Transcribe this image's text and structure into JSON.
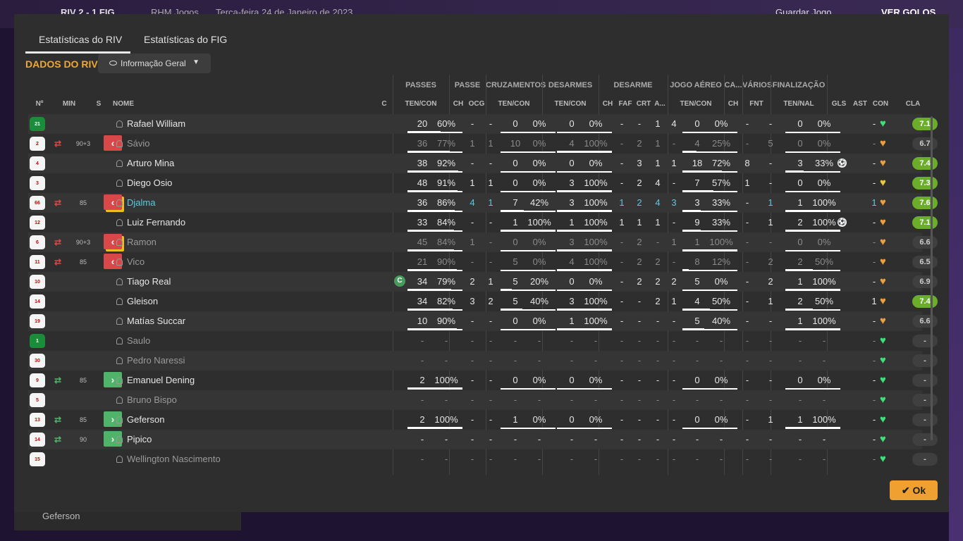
{
  "background": {
    "match_header": "RIV   2 - 1   FIG",
    "subtitle": "RHM Jogos",
    "date": "Terça-feira 24 de Janeiro de 2023",
    "save_button": "Guardar Jogo",
    "goals_button": "VER GOLOS",
    "bottom_player": "Geferson"
  },
  "tabs": [
    "Estatísticas do RIV",
    "Estatísticas do FIG"
  ],
  "section_title": "DADOS DO RIV",
  "dropdown": {
    "icon": "eye-icon",
    "label": "Informação Geral"
  },
  "groups": [
    "PASSES",
    "PASSE",
    "CRUZAMENTOS",
    "DESARMES",
    "DESARME",
    "JOGO AÉREO",
    "CA...",
    "VÁRIOS",
    "FINALIZAÇÃO"
  ],
  "columns": {
    "num": "Nº",
    "min": "MIN",
    "s": "S",
    "name": "NOME",
    "c": "C",
    "pass": "TEN/CON",
    "ch": "CH",
    "ocg": "OCG",
    "cross": "TEN/CON",
    "tack": "TEN/CON",
    "dch": "CH",
    "faf": "FAF",
    "crt": "CRT",
    "a": "A...",
    "air": "TEN/CON",
    "cach": "CH",
    "fnt": "FNT",
    "fin": "TEN/NAL",
    "gls": "GLS",
    "ast": "AST",
    "con": "CON",
    "cla": "CLA"
  },
  "colors": {
    "accent": "#f0a830",
    "green": "#4fb36a",
    "red": "#d84848",
    "rating_high": "#6aae2c",
    "cyan": "#5fc8e0"
  },
  "players": [
    {
      "num": "21",
      "gk": true,
      "min": "",
      "sub": "",
      "name": "Rafael William",
      "c": "",
      "style": "",
      "pass": [
        "20",
        "60%"
      ],
      "ch": "-",
      "ocg": "-",
      "cross": [
        "0",
        "0%"
      ],
      "tack": [
        "0",
        "0%"
      ],
      "dch": "-",
      "faf": "-",
      "crt": "1",
      "a": "4",
      "air": [
        "0",
        "0%"
      ],
      "cach": "-",
      "fnt": "-",
      "fin": [
        "0",
        "0%"
      ],
      "gls": "",
      "ast": "-",
      "con": "green",
      "cla": "7.1",
      "high": true,
      "bars": {
        "pass": 0.6,
        "cross": 0,
        "tack": 0,
        "air": 0,
        "fin": 0
      }
    },
    {
      "num": "2",
      "gk": false,
      "min": "90+3",
      "sub": "out",
      "name": "Sávio",
      "c": "",
      "style": "dim",
      "pass": [
        "36",
        "77%"
      ],
      "ch": "1",
      "ocg": "1",
      "cross": [
        "10",
        "0%"
      ],
      "tack": [
        "4",
        "100%"
      ],
      "dch": "-",
      "faf": "2",
      "crt": "1",
      "a": "-",
      "air": [
        "4",
        "25%"
      ],
      "cach": "-",
      "fnt": "5",
      "fin": [
        "0",
        "0%"
      ],
      "gls": "",
      "ast": "-",
      "con": "orange",
      "cla": "6.7",
      "high": false,
      "bars": {
        "pass": 0.77,
        "cross": 0,
        "tack": 1,
        "air": 0.25,
        "fin": 0
      }
    },
    {
      "num": "4",
      "gk": false,
      "min": "",
      "sub": "",
      "name": "Arturo Mina",
      "c": "",
      "style": "",
      "pass": [
        "38",
        "92%"
      ],
      "ch": "-",
      "ocg": "-",
      "cross": [
        "0",
        "0%"
      ],
      "tack": [
        "0",
        "0%"
      ],
      "dch": "-",
      "faf": "3",
      "crt": "1",
      "a": "1",
      "air": [
        "18",
        "72%"
      ],
      "cach": "8",
      "fnt": "-",
      "fin": [
        "3",
        "33%"
      ],
      "gls": "ball",
      "ast": "-",
      "con": "orange",
      "cla": "7.4",
      "high": true,
      "bars": {
        "pass": 0.92,
        "cross": 0,
        "tack": 0,
        "air": 0.72,
        "fin": 0.33
      }
    },
    {
      "num": "3",
      "gk": false,
      "min": "",
      "sub": "",
      "name": "Diego Osio",
      "c": "",
      "style": "",
      "pass": [
        "48",
        "91%"
      ],
      "ch": "1",
      "ocg": "1",
      "cross": [
        "0",
        "0%"
      ],
      "tack": [
        "3",
        "100%"
      ],
      "dch": "-",
      "faf": "2",
      "crt": "4",
      "a": "-",
      "air": [
        "7",
        "57%"
      ],
      "cach": "1",
      "fnt": "-",
      "fin": [
        "0",
        "0%"
      ],
      "gls": "",
      "ast": "-",
      "con": "yellow",
      "cla": "7.3",
      "high": true,
      "bars": {
        "pass": 0.91,
        "cross": 0,
        "tack": 1,
        "air": 0.57,
        "fin": 0
      }
    },
    {
      "num": "66",
      "gk": false,
      "min": "85",
      "sub": "out-yellow",
      "name": "Djalma",
      "c": "",
      "style": "cyan",
      "pass": [
        "36",
        "86%"
      ],
      "ch": "4",
      "ocg": "1",
      "cross": [
        "7",
        "42%"
      ],
      "tack": [
        "3",
        "100%"
      ],
      "dch": "1",
      "faf": "2",
      "crt": "4",
      "a": "3",
      "air": [
        "3",
        "33%"
      ],
      "cach": "-",
      "fnt": "1",
      "fin": [
        "1",
        "100%"
      ],
      "gls": "",
      "ast": "1",
      "con": "orange",
      "cla": "7.6",
      "high": true,
      "bars": {
        "pass": 0.86,
        "cross": 0.42,
        "tack": 1,
        "air": 0.33,
        "fin": 1
      }
    },
    {
      "num": "12",
      "gk": false,
      "min": "",
      "sub": "",
      "name": "Luiz Fernando",
      "c": "",
      "style": "",
      "pass": [
        "33",
        "84%"
      ],
      "ch": "-",
      "ocg": "-",
      "cross": [
        "1",
        "100%"
      ],
      "tack": [
        "1",
        "100%"
      ],
      "dch": "1",
      "faf": "1",
      "crt": "1",
      "a": "-",
      "air": [
        "9",
        "33%"
      ],
      "cach": "-",
      "fnt": "1",
      "fin": [
        "2",
        "100%"
      ],
      "gls": "ball",
      "ast": "-",
      "con": "orange",
      "cla": "7.1",
      "high": true,
      "bars": {
        "pass": 0.84,
        "cross": 1,
        "tack": 1,
        "air": 0.33,
        "fin": 1
      }
    },
    {
      "num": "6",
      "gk": false,
      "min": "90+3",
      "sub": "out-yellow",
      "name": "Ramon",
      "c": "",
      "style": "dim",
      "pass": [
        "45",
        "84%"
      ],
      "ch": "1",
      "ocg": "-",
      "cross": [
        "0",
        "0%"
      ],
      "tack": [
        "3",
        "100%"
      ],
      "dch": "-",
      "faf": "2",
      "crt": "-",
      "a": "1",
      "air": [
        "1",
        "100%"
      ],
      "cach": "-",
      "fnt": "-",
      "fin": [
        "0",
        "0%"
      ],
      "gls": "",
      "ast": "-",
      "con": "orange",
      "cla": "6.6",
      "high": false,
      "bars": {
        "pass": 0.84,
        "cross": 0,
        "tack": 1,
        "air": 1,
        "fin": 0
      }
    },
    {
      "num": "11",
      "gk": false,
      "min": "85",
      "sub": "out",
      "name": "Vico",
      "c": "",
      "style": "dim",
      "pass": [
        "21",
        "90%"
      ],
      "ch": "-",
      "ocg": "-",
      "cross": [
        "5",
        "0%"
      ],
      "tack": [
        "4",
        "100%"
      ],
      "dch": "-",
      "faf": "2",
      "crt": "2",
      "a": "-",
      "air": [
        "8",
        "12%"
      ],
      "cach": "-",
      "fnt": "2",
      "fin": [
        "2",
        "50%"
      ],
      "gls": "",
      "ast": "-",
      "con": "orange",
      "cla": "6.5",
      "high": false,
      "bars": {
        "pass": 0.9,
        "cross": 0,
        "tack": 1,
        "air": 0.12,
        "fin": 0.5
      }
    },
    {
      "num": "10",
      "gk": false,
      "min": "",
      "sub": "",
      "name": "Tiago Real",
      "c": "C",
      "style": "",
      "pass": [
        "34",
        "79%"
      ],
      "ch": "2",
      "ocg": "1",
      "cross": [
        "5",
        "20%"
      ],
      "tack": [
        "0",
        "0%"
      ],
      "dch": "-",
      "faf": "2",
      "crt": "2",
      "a": "2",
      "air": [
        "5",
        "0%"
      ],
      "cach": "-",
      "fnt": "2",
      "fin": [
        "1",
        "100%"
      ],
      "gls": "",
      "ast": "-",
      "con": "orange",
      "cla": "6.9",
      "high": false,
      "bars": {
        "pass": 0.79,
        "cross": 0.2,
        "tack": 0,
        "air": 0,
        "fin": 1
      }
    },
    {
      "num": "14",
      "gk": false,
      "min": "",
      "sub": "",
      "name": "Gleison",
      "c": "",
      "style": "",
      "pass": [
        "34",
        "82%"
      ],
      "ch": "3",
      "ocg": "2",
      "cross": [
        "5",
        "40%"
      ],
      "tack": [
        "3",
        "100%"
      ],
      "dch": "-",
      "faf": "-",
      "crt": "2",
      "a": "1",
      "air": [
        "4",
        "50%"
      ],
      "cach": "-",
      "fnt": "1",
      "fin": [
        "2",
        "50%"
      ],
      "gls": "",
      "ast": "1",
      "con": "orange",
      "cla": "7.4",
      "high": true,
      "bars": {
        "pass": 0.82,
        "cross": 0.4,
        "tack": 1,
        "air": 0.5,
        "fin": 0.5
      }
    },
    {
      "num": "19",
      "gk": false,
      "min": "",
      "sub": "",
      "name": "Matías Succar",
      "c": "",
      "style": "",
      "pass": [
        "10",
        "90%"
      ],
      "ch": "-",
      "ocg": "-",
      "cross": [
        "0",
        "0%"
      ],
      "tack": [
        "1",
        "100%"
      ],
      "dch": "-",
      "faf": "-",
      "crt": "-",
      "a": "-",
      "air": [
        "5",
        "40%"
      ],
      "cach": "-",
      "fnt": "-",
      "fin": [
        "1",
        "100%"
      ],
      "gls": "",
      "ast": "-",
      "con": "orange",
      "cla": "6.6",
      "high": false,
      "bars": {
        "pass": 0.9,
        "cross": 0,
        "tack": 1,
        "air": 0.4,
        "fin": 1
      }
    },
    {
      "num": "1",
      "gk": true,
      "min": "",
      "sub": "",
      "name": "Saulo",
      "c": "",
      "style": "dim",
      "pass": [
        "-",
        "-"
      ],
      "ch": "-",
      "ocg": "-",
      "cross": [
        "-",
        "-"
      ],
      "tack": [
        "-",
        "-"
      ],
      "dch": "-",
      "faf": "-",
      "crt": "-",
      "a": "-",
      "air": [
        "-",
        "-"
      ],
      "cach": "-",
      "fnt": "-",
      "fin": [
        "-",
        "-"
      ],
      "gls": "",
      "ast": "-",
      "con": "green",
      "cla": "-",
      "high": false,
      "bars": {}
    },
    {
      "num": "30",
      "gk": false,
      "min": "",
      "sub": "",
      "name": "Pedro Naressi",
      "c": "",
      "style": "dim",
      "pass": [
        "-",
        "-"
      ],
      "ch": "-",
      "ocg": "-",
      "cross": [
        "-",
        "-"
      ],
      "tack": [
        "-",
        "-"
      ],
      "dch": "-",
      "faf": "-",
      "crt": "-",
      "a": "-",
      "air": [
        "-",
        "-"
      ],
      "cach": "-",
      "fnt": "-",
      "fin": [
        "-",
        "-"
      ],
      "gls": "",
      "ast": "-",
      "con": "green",
      "cla": "-",
      "high": false,
      "bars": {}
    },
    {
      "num": "9",
      "gk": false,
      "min": "85",
      "sub": "in",
      "name": "Emanuel Dening",
      "c": "",
      "style": "",
      "pass": [
        "2",
        "100%"
      ],
      "ch": "-",
      "ocg": "-",
      "cross": [
        "0",
        "0%"
      ],
      "tack": [
        "0",
        "0%"
      ],
      "dch": "-",
      "faf": "-",
      "crt": "-",
      "a": "-",
      "air": [
        "0",
        "0%"
      ],
      "cach": "-",
      "fnt": "-",
      "fin": [
        "0",
        "0%"
      ],
      "gls": "",
      "ast": "-",
      "con": "green",
      "cla": "-",
      "high": false,
      "bars": {
        "pass": 1,
        "cross": 0,
        "tack": 0,
        "air": 0,
        "fin": 0
      }
    },
    {
      "num": "5",
      "gk": false,
      "min": "",
      "sub": "",
      "name": "Bruno Bispo",
      "c": "",
      "style": "dim",
      "pass": [
        "-",
        "-"
      ],
      "ch": "-",
      "ocg": "-",
      "cross": [
        "-",
        "-"
      ],
      "tack": [
        "-",
        "-"
      ],
      "dch": "-",
      "faf": "-",
      "crt": "-",
      "a": "-",
      "air": [
        "-",
        "-"
      ],
      "cach": "-",
      "fnt": "-",
      "fin": [
        "-",
        "-"
      ],
      "gls": "",
      "ast": "-",
      "con": "green",
      "cla": "-",
      "high": false,
      "bars": {}
    },
    {
      "num": "13",
      "gk": false,
      "min": "85",
      "sub": "in",
      "name": "Geferson",
      "c": "",
      "style": "",
      "pass": [
        "2",
        "100%"
      ],
      "ch": "-",
      "ocg": "-",
      "cross": [
        "1",
        "0%"
      ],
      "tack": [
        "0",
        "0%"
      ],
      "dch": "-",
      "faf": "-",
      "crt": "-",
      "a": "-",
      "air": [
        "0",
        "0%"
      ],
      "cach": "-",
      "fnt": "1",
      "fin": [
        "1",
        "100%"
      ],
      "gls": "",
      "ast": "-",
      "con": "green",
      "cla": "-",
      "high": false,
      "bars": {
        "pass": 1,
        "cross": 0,
        "tack": 0,
        "air": 0,
        "fin": 1
      }
    },
    {
      "num": "14",
      "gk": false,
      "min": "90",
      "sub": "in",
      "name": "Pipico",
      "c": "",
      "style": "",
      "pass": [
        "-",
        "-"
      ],
      "ch": "-",
      "ocg": "-",
      "cross": [
        "-",
        "-"
      ],
      "tack": [
        "-",
        "-"
      ],
      "dch": "-",
      "faf": "-",
      "crt": "-",
      "a": "-",
      "air": [
        "-",
        "-"
      ],
      "cach": "-",
      "fnt": "-",
      "fin": [
        "-",
        "-"
      ],
      "gls": "",
      "ast": "-",
      "con": "green",
      "cla": "-",
      "high": false,
      "bars": {}
    },
    {
      "num": "15",
      "gk": false,
      "min": "",
      "sub": "",
      "name": "Wellington Nascimento",
      "c": "",
      "style": "dim",
      "pass": [
        "-",
        "-"
      ],
      "ch": "-",
      "ocg": "-",
      "cross": [
        "-",
        "-"
      ],
      "tack": [
        "-",
        "-"
      ],
      "dch": "-",
      "faf": "-",
      "crt": "-",
      "a": "-",
      "air": [
        "-",
        "-"
      ],
      "cach": "-",
      "fnt": "-",
      "fin": [
        "-",
        "-"
      ],
      "gls": "",
      "ast": "-",
      "con": "green",
      "cla": "-",
      "high": false,
      "bars": {}
    }
  ],
  "ok_button": "Ok"
}
